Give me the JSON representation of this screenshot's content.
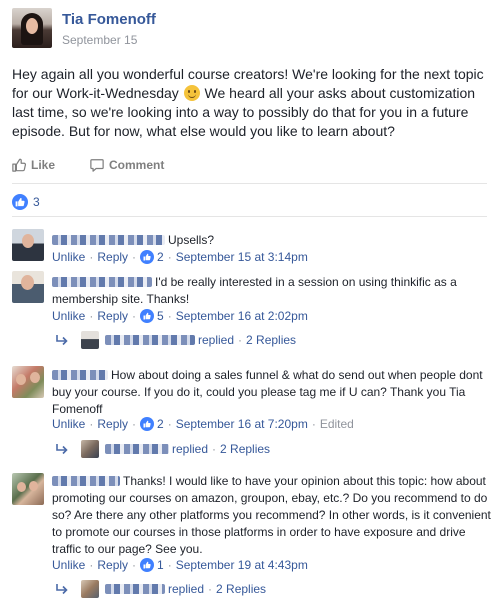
{
  "post": {
    "author": "Tia Fomenoff",
    "date": "September 15",
    "body_before_emoji": "Hey again all you wonderful course creators! We're looking for the next topic for our Work-it-Wednesday",
    "body_after_emoji": " We heard all your asks about customization last time, so we're looking into a way to possibly do that for you in a future episode. But for now, what else would you like to learn about?"
  },
  "actions": {
    "like": "Like",
    "comment": "Comment"
  },
  "reactions": {
    "count": "3"
  },
  "comments": [
    {
      "text": "Upsells?",
      "unlike": "Unlike",
      "reply": "Reply",
      "likes": "2",
      "time": "September 15 at 3:14pm"
    },
    {
      "text": "I'd be really interested in a session on using thinkific as a membership site. Thanks!",
      "unlike": "Unlike",
      "reply": "Reply",
      "likes": "5",
      "time": "September 16 at 2:02pm",
      "replied": "replied",
      "reply_count": "2 Replies"
    },
    {
      "text": "How about doing a sales funnel & what do send out when people dont buy your course. If you do it, could you please tag me if U can? Thank you Tia Fomenoff",
      "unlike": "Unlike",
      "reply": "Reply",
      "likes": "2",
      "time": "September 16 at 7:20pm",
      "edited": "Edited",
      "replied": "replied",
      "reply_count": "2 Replies"
    },
    {
      "text": "Thanks! I would like to have your opinion about this topic: how about promoting our courses on amazon, groupon, ebay, etc.? Do you recommend to do so? Are there any other platforms you recommend? In other words, is it convenient to promote our courses in those platforms in order to have exposure and drive traffic to our page? See you.",
      "unlike": "Unlike",
      "reply": "Reply",
      "likes": "1",
      "time": "September 19 at 4:43pm",
      "replied": "replied",
      "reply_count": "2 Replies"
    }
  ],
  "colors": {
    "link": "#365899",
    "meta": "#90949c",
    "like_blue": "#4080ff",
    "text": "#1d2129"
  },
  "icons": [
    "thumbs-up-icon",
    "comment-bubble-icon",
    "like-reaction-icon",
    "reply-arrow-icon",
    "smiley-emoji-icon"
  ]
}
